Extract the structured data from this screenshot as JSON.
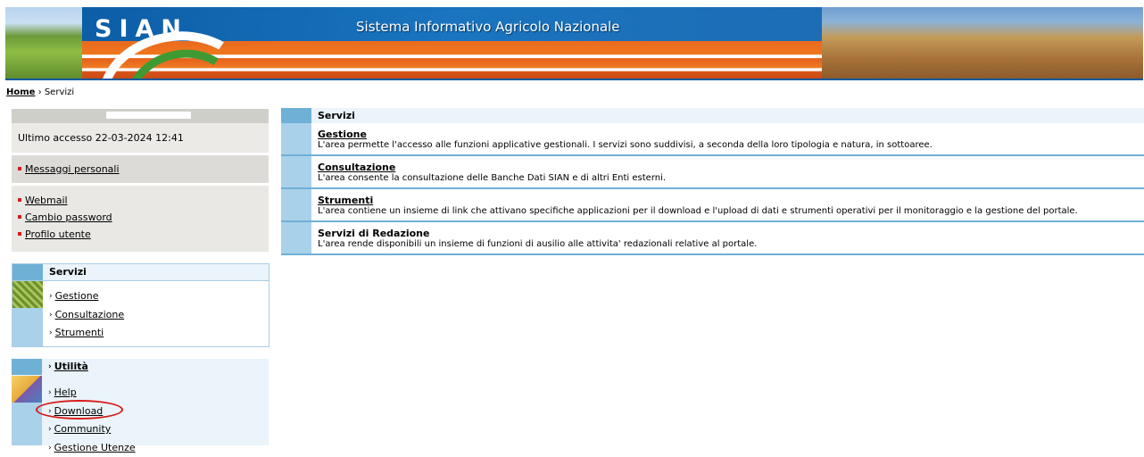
{
  "header": {
    "logo": "SIAN",
    "title": "Sistema Informativo Agricolo Nazionale"
  },
  "breadcrumb": {
    "home": "Home",
    "separator": "›",
    "current": "Servizi"
  },
  "user": {
    "last_access": "Ultimo accesso 22-03-2024 12:41",
    "messages_link": "Messaggi personali",
    "links": [
      "Webmail",
      "Cambio password",
      "Profilo utente"
    ]
  },
  "servizi_box": {
    "title": "Servizi",
    "items": [
      "Gestione",
      "Consultazione",
      "Strumenti"
    ]
  },
  "utilita_box": {
    "title": "Utilità",
    "items": [
      "Help",
      "Download",
      "Community",
      "Gestione Utenze"
    ]
  },
  "main": {
    "title": "Servizi",
    "services": [
      {
        "title": "Gestione",
        "description": "L'area permette l'accesso alle funzioni applicative gestionali. I servizi sono suddivisi, a seconda della loro tipologia e natura, in sottoaree."
      },
      {
        "title": "Consultazione",
        "description": "L'area consente la consultazione delle Banche Dati SIAN e di altri Enti esterni."
      },
      {
        "title": "Strumenti",
        "description": "L'area contiene un insieme di link che attivano specifiche applicazioni per il download e l'upload di dati e strumenti operativi per il monitoraggio e la gestione del portale."
      },
      {
        "title": "Servizi di Redazione",
        "description": "L'area rende disponibili un insieme di funzioni di ausilio alle attivita' redazionali relative al portale."
      }
    ]
  },
  "colors": {
    "accent_blue": "#6fb0d6",
    "light_blue": "#a9d1ea",
    "header_blue": "#0a5aa0",
    "bullet_red": "#d11d1d",
    "highlight_circle": "#d81818"
  },
  "icons": {
    "servizi_image": "wheat-field-image",
    "utilita_image": "tools-image",
    "bullet": "red-square-bullet-icon",
    "chevron": "chevron-right-icon"
  }
}
